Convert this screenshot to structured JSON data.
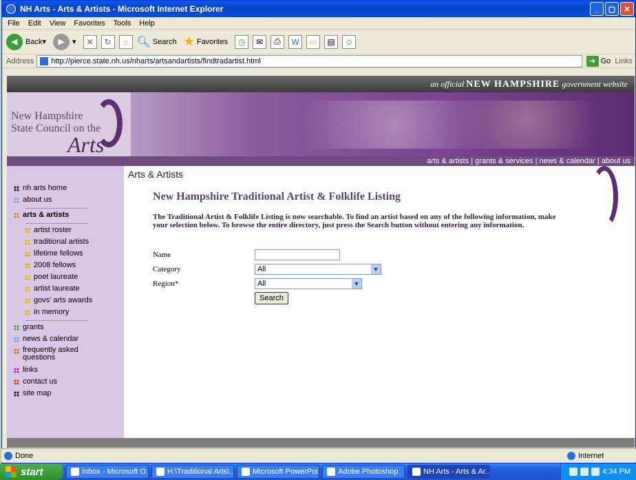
{
  "window": {
    "title": "NH Arts - Arts & Artists - Microsoft Internet Explorer"
  },
  "menubar": [
    "File",
    "Edit",
    "View",
    "Favorites",
    "Tools",
    "Help"
  ],
  "toolbar": {
    "back_label": "Back",
    "search_label": "Search",
    "favorites_label": "Favorites"
  },
  "address": {
    "label": "Address",
    "url": "http://pierce.state.nh.us/nharts/artsandartists/findtradartist.html",
    "go_label": "Go",
    "links_label": "Links"
  },
  "site": {
    "official_prefix": "an official",
    "official_state": "NEW HAMPSHIRE",
    "official_suffix": "government website",
    "logo_line1": "New Hampshire",
    "logo_line2": "State Council on the",
    "logo_arts": "Arts",
    "nav": "arts & artists | grants & services | news & calendar | about us"
  },
  "sidebar": {
    "items": [
      {
        "label": "nh arts home",
        "color": "#222222"
      },
      {
        "label": "about us",
        "color": "#7fa8d8"
      },
      {
        "label": "arts & artists",
        "color": "#e08a1e"
      },
      {
        "label": "artist roster",
        "color": "#f0b400"
      },
      {
        "label": "traditional artists",
        "color": "#f0b400"
      },
      {
        "label": "lifetime fellows",
        "color": "#f0b400"
      },
      {
        "label": "2008 fellows",
        "color": "#f0b400"
      },
      {
        "label": "poet laureate",
        "color": "#f0b400"
      },
      {
        "label": "artist laureate",
        "color": "#f0b400"
      },
      {
        "label": "govs' arts awards",
        "color": "#f0b400"
      },
      {
        "label": "in memory",
        "color": "#f0b400"
      },
      {
        "label": "grants",
        "color": "#4aa04a"
      },
      {
        "label": "news & calendar",
        "color": "#7fa8d8"
      },
      {
        "label": "frequently asked questions",
        "color": "#e0721e"
      },
      {
        "label": "links",
        "color": "#c02aa0"
      },
      {
        "label": "contact us",
        "color": "#d83a2a"
      },
      {
        "label": "site map",
        "color": "#222222"
      }
    ]
  },
  "main": {
    "page_title": "Arts & Artists",
    "listing_title": "New Hampshire Traditional Artist & Folklife Listing",
    "intro": "The Traditional Artist & Folklife Listing is now searchable. To find an artist based on any of the following information, make your selection below. To browse the entire directory, just press the Search button without entering any information.",
    "form": {
      "name_label": "Name",
      "name_value": "",
      "category_label": "Category",
      "category_value": "All",
      "region_label": "Region*",
      "region_value": "All",
      "search_button": "Search"
    }
  },
  "status": {
    "text": "Done",
    "zone": "Internet"
  },
  "taskbar": {
    "start": "start",
    "tasks": [
      "Inbox - Microsoft O...",
      "H:\\Traditional Arts\\...",
      "Microsoft PowerPoi...",
      "Adobe Photoshop",
      "NH Arts - Arts & Ar..."
    ],
    "clock": "4:34 PM"
  }
}
